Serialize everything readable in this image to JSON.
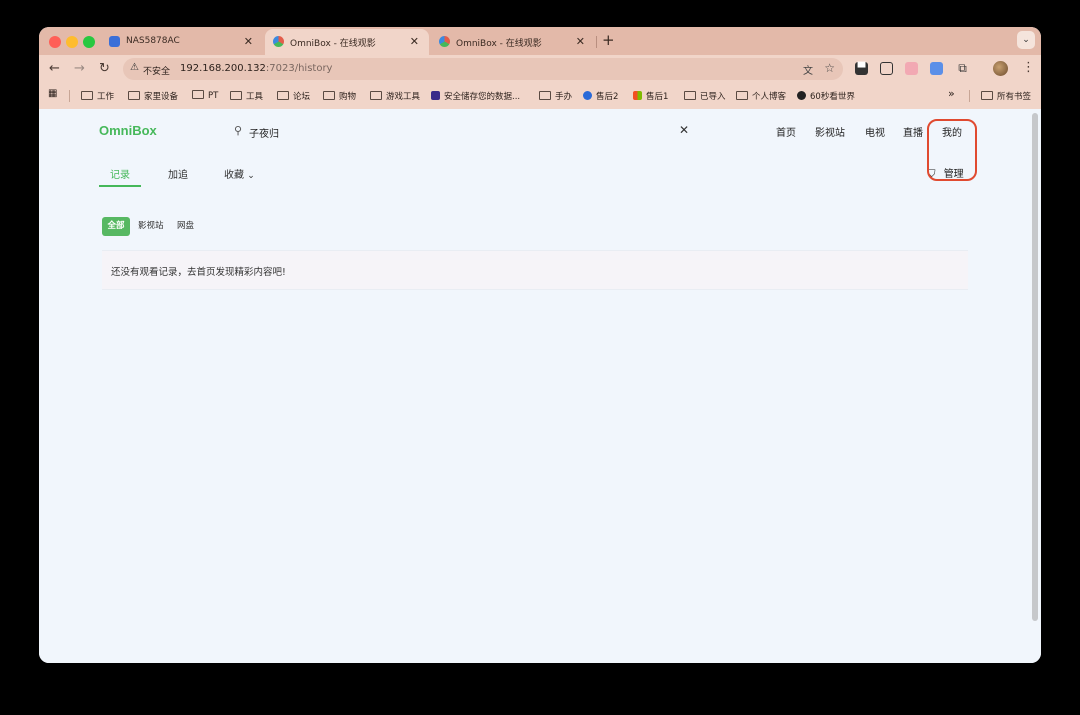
{
  "browser": {
    "tabs": [
      {
        "title": "NAS5878AC",
        "active": false
      },
      {
        "title": "OmniBox - 在线观影",
        "active": true
      },
      {
        "title": "OmniBox - 在线观影",
        "active": false
      }
    ],
    "new_tab": "+",
    "close_glyph": "✕",
    "tab_search_glyph": "⌄",
    "address": {
      "security_label": "不安全",
      "host": "192.168.200.132",
      "path": ":7023/history"
    },
    "bookmarks": [
      "工作",
      "家里设备",
      "PT",
      "工具",
      "论坛",
      "购物",
      "游戏工具",
      "安全储存您的数据...",
      "手办",
      "售后2",
      "售后1",
      "已导入",
      "个人博客",
      "60秒看世界"
    ],
    "bookmarks_overflow": "»",
    "all_bookmarks": "所有书签"
  },
  "app": {
    "logo": "OmniBox",
    "search": {
      "value": "子夜归",
      "clear_glyph": "✕"
    },
    "nav": [
      "首页",
      "影视站",
      "电视",
      "直播",
      "我的"
    ],
    "subtabs": [
      "记录",
      "加追",
      "收藏"
    ],
    "active_subtab": "记录",
    "dropdown_item": "管理",
    "filters": [
      "全部",
      "影视站",
      "网盘"
    ],
    "active_filter": "全部",
    "empty_message": "还没有观看记录，去首页发现精彩内容吧!"
  },
  "colors": {
    "accent": "#46b85a",
    "highlight_box": "#e04a30",
    "tab_strip": "#e3b9a9",
    "page_bg": "#f1f6fc"
  },
  "icons": {
    "back": "arrow-left-icon",
    "forward": "arrow-right-icon",
    "reload": "reload-icon",
    "search": "search-icon",
    "shield": "shield-icon",
    "chevron": "chevron-down-icon"
  }
}
